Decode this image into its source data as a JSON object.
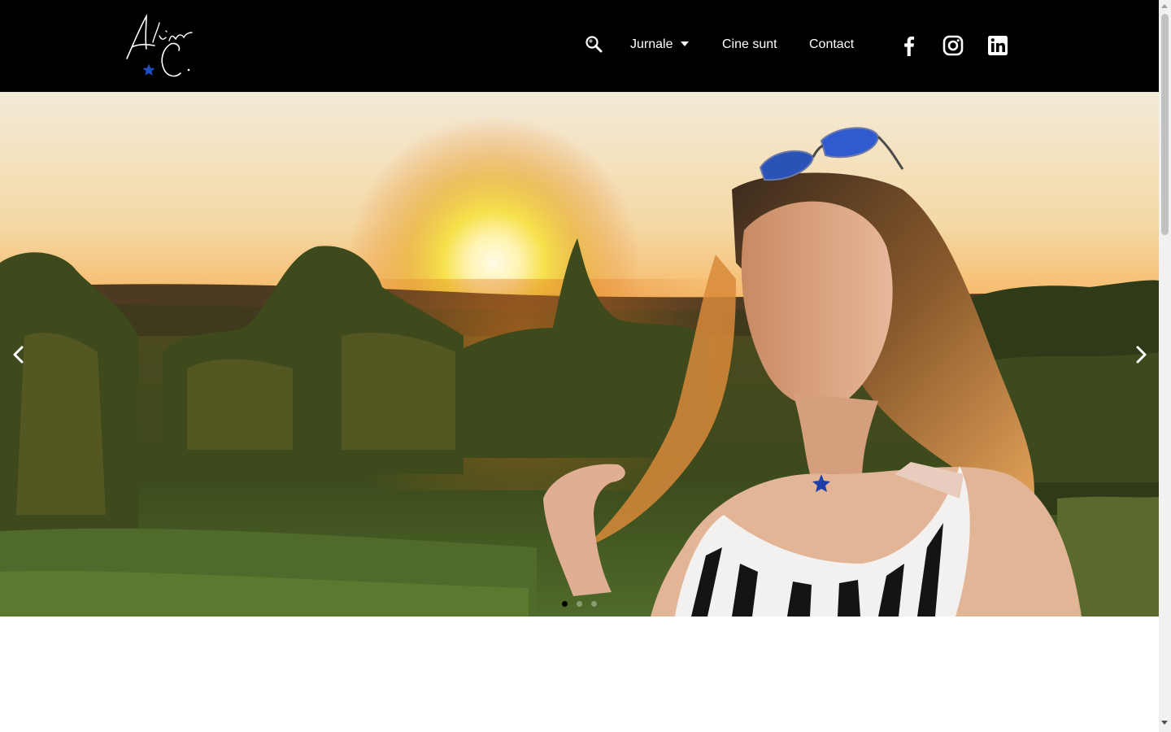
{
  "header": {
    "logo": {
      "text": "Adina C.",
      "icon": "star-icon",
      "star_color": "#1f4fbf"
    },
    "nav": {
      "search_icon": "search-icon",
      "items": [
        {
          "label": "Jurnale",
          "has_dropdown": true
        },
        {
          "label": "Cine sunt"
        },
        {
          "label": "Contact"
        }
      ]
    },
    "social": [
      {
        "name": "facebook",
        "icon": "facebook-icon"
      },
      {
        "name": "instagram",
        "icon": "instagram-icon"
      },
      {
        "name": "linkedin",
        "icon": "linkedin-icon"
      }
    ]
  },
  "hero": {
    "image": "woman-in-vineyard-at-sunset",
    "prev_icon": "chevron-left-icon",
    "next_icon": "chevron-right-icon",
    "slides_total": 3,
    "active_slide": 1
  },
  "colors": {
    "header_bg": "#000000",
    "nav_text": "#ffffff",
    "page_bg": "#ffffff",
    "sky_top": "#f3ead8",
    "sun": "#fff6c8"
  }
}
